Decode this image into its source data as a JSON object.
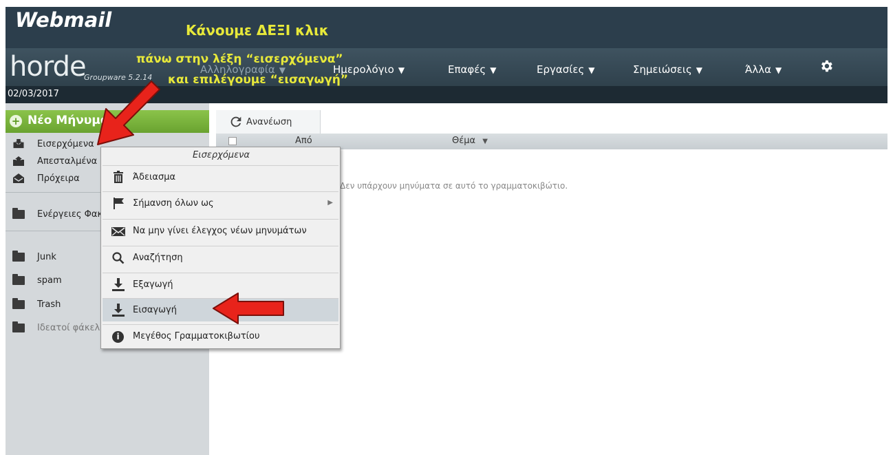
{
  "header": {
    "webmail_logo": "Webmail",
    "horde_logo": "horde",
    "groupware_label": "Groupware 5.2.14",
    "caption_line1": "Κάνουμε ΔΕΞΙ κλικ",
    "caption_line2": "πάνω στην λέξη “εισερχόμενα”",
    "caption_line3": "και επιλέγουμε “εισαγωγή”",
    "caption_color": "#e8e93a"
  },
  "nav": {
    "items": [
      {
        "label": "Αλληλογραφία",
        "caret": "▼"
      },
      {
        "label": "Ημερολόγιο",
        "caret": "▼"
      },
      {
        "label": "Επαφές",
        "caret": "▼"
      },
      {
        "label": "Εργασίες",
        "caret": "▼"
      },
      {
        "label": "Σημειώσεις",
        "caret": "▼"
      },
      {
        "label": "Άλλα",
        "caret": "▼"
      }
    ],
    "settings_icon": "gear-icon"
  },
  "datebar": {
    "date": "02/03/2017"
  },
  "sidebar": {
    "new_message": "Νέο Μήνυμα",
    "folders": [
      {
        "label": "Εισερχόμενα",
        "icon": "inbox-icon"
      },
      {
        "label": "Απεσταλμένα",
        "icon": "sent-icon"
      },
      {
        "label": "Πρόχειρα",
        "icon": "drafts-icon"
      },
      {
        "label": "Ενέργειες Φακέλων",
        "icon": "folder-icon"
      },
      {
        "label": "Junk",
        "icon": "folder-icon"
      },
      {
        "label": "spam",
        "icon": "folder-icon"
      },
      {
        "label": "Trash",
        "icon": "folder-icon"
      },
      {
        "label": "Ιδεατοί φάκελοι",
        "icon": "virtual-folder-icon"
      }
    ]
  },
  "main": {
    "refresh_label": "Ανανέωση",
    "columns": {
      "from": "Από",
      "subject": "Θέμα",
      "subject_caret": "▼"
    },
    "empty_message": "Δεν υπάρχουν μηνύματα σε αυτό το γραμματοκιβώτιο."
  },
  "context_menu": {
    "title": "Εισερχόμενα",
    "items": [
      {
        "label": "Άδειασμα",
        "icon": "trash-icon"
      },
      {
        "label": "Σήμανση όλων ως",
        "icon": "flag-icon",
        "submenu": "▶"
      },
      {
        "label": "Να μην γίνει έλεγχος νέων μηνυμάτων",
        "icon": "envelope-icon"
      },
      {
        "label": "Αναζήτηση",
        "icon": "search-icon"
      },
      {
        "label": "Εξαγωγή",
        "icon": "download-icon"
      },
      {
        "label": "Εισαγωγή",
        "icon": "download-icon",
        "highlighted": true
      },
      {
        "label": "Μεγέθος Γραμματοκιβωτίου",
        "icon": "info-icon"
      }
    ]
  },
  "colors": {
    "top_band": "#2c3e4c",
    "new_message_green": "#7ab83b",
    "sidebar_bg": "#d4d8db",
    "annotation_arrow": "#e8231b"
  }
}
